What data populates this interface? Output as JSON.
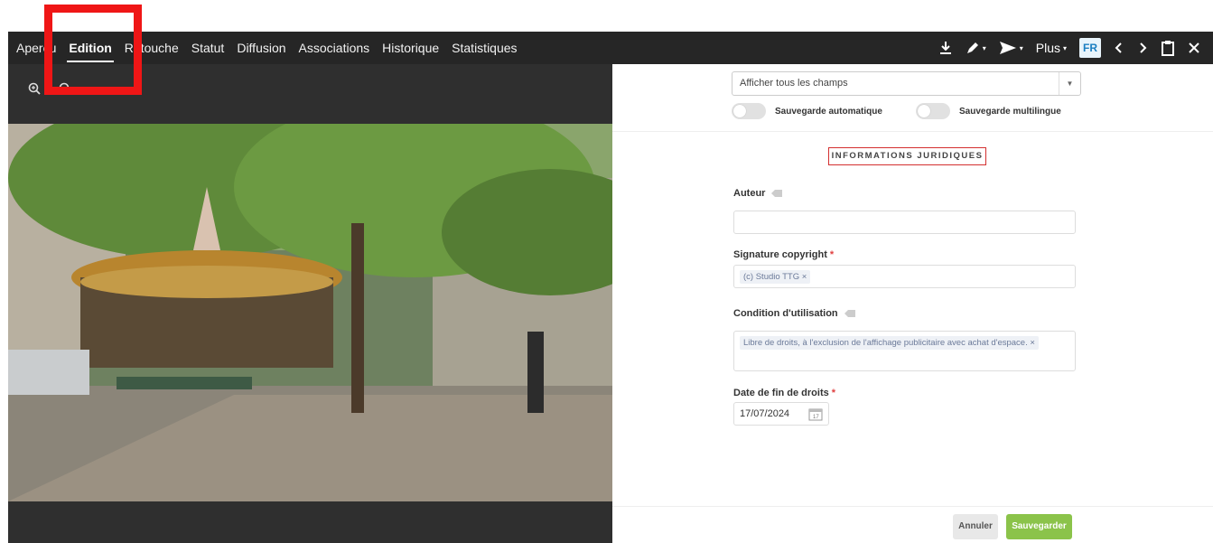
{
  "tabs": [
    {
      "label": "Aperçu"
    },
    {
      "label": "Edition",
      "active": true
    },
    {
      "label": "Retouche"
    },
    {
      "label": "Statut"
    },
    {
      "label": "Diffusion"
    },
    {
      "label": "Associations"
    },
    {
      "label": "Historique"
    },
    {
      "label": "Statistiques"
    }
  ],
  "toolbar": {
    "download_icon": "download-icon",
    "edit_icon": "pencil-icon",
    "send_icon": "send-icon",
    "more_label": "Plus",
    "language": "FR",
    "prev_icon": "chevron-left-icon",
    "next_icon": "chevron-right-icon",
    "clipboard_icon": "clipboard-icon",
    "close_icon": "close-icon"
  },
  "viewer": {
    "zoom_in_icon": "zoom-in-icon",
    "zoom_out_icon": "zoom-out-icon",
    "image_alt": "Carousel under trees in a Paris square"
  },
  "form": {
    "display_select": "Afficher tous les champs",
    "autosave_label": "Sauvegarde automatique",
    "multilang_label": "Sauvegarde multilingue",
    "section_title": "INFORMATIONS JURIDIQUES",
    "author_label": "Auteur",
    "author_value": "",
    "copyright_label": "Signature copyright",
    "copyright_chip": "(c) Studio TTG ×",
    "usage_label": "Condition d'utilisation",
    "usage_chip": "Libre de droits, à l'exclusion de l'affichage publicitaire avec achat d'espace. ×",
    "rights_end_label": "Date de fin de droits",
    "rights_end_value": "17/07/2024",
    "required_mark": "*",
    "cancel_label": "Annuler",
    "save_label": "Sauvegarder"
  },
  "colors": {
    "topbar": "#262626",
    "highlight": "#ef1616",
    "save_button": "#8bc34a",
    "required": "#e04040",
    "lang_badge": "#1b7fc1"
  }
}
